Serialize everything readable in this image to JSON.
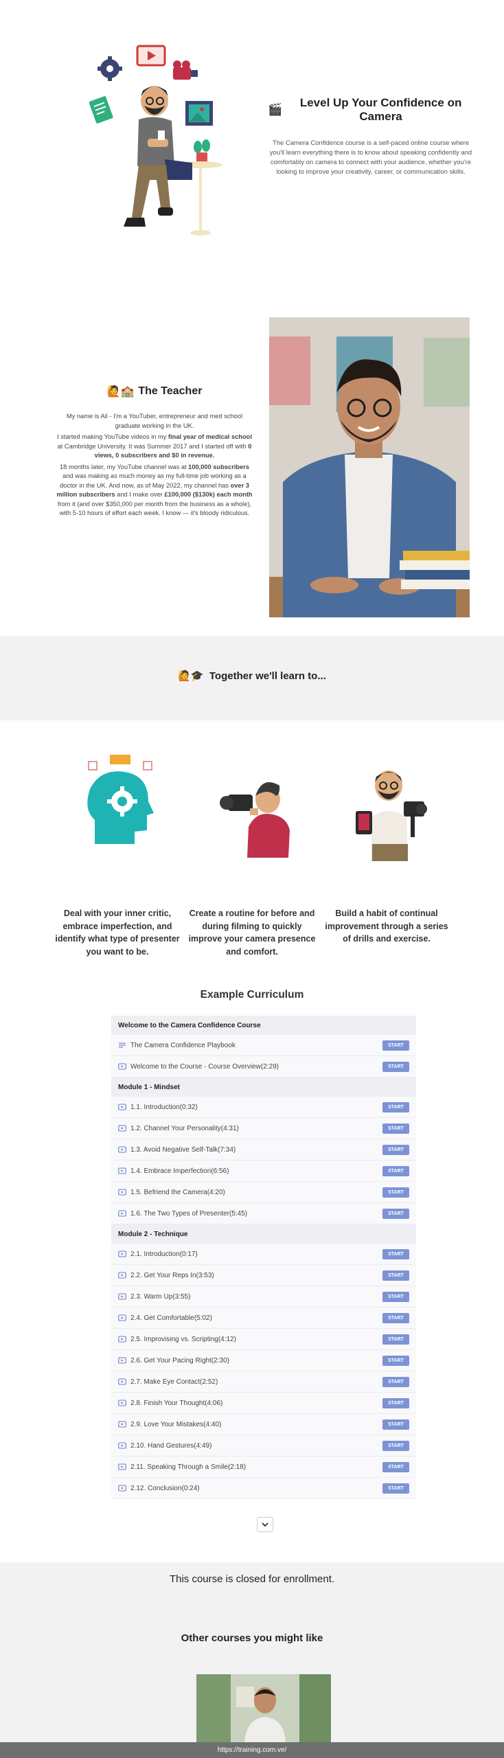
{
  "hero": {
    "title": "Level Up Your Confidence on Camera",
    "title_emoji": "🎬",
    "description": "The Camera Confidence course is a self-paced online course where you'll learn everything there is to know about speaking confidently and comfortably on camera to connect with your audience, whether you're looking to improve your creativity, career, or communication skills."
  },
  "teacher": {
    "title": "The Teacher",
    "title_emoji": "🙋🏫",
    "p1": "My name is Ali - I'm a YouTuber, entrepreneur and med school graduate working in the UK.",
    "p2_a": "I started making YouTube videos in my ",
    "p2_b": "final year of medical school",
    "p2_c": " at Cambridge University. It was Summer 2017 and I started off with ",
    "p2_d": "0 views, 0 subscribers and $0 in revenue.",
    "p3_a": "18 months later, my YouTube channel was at ",
    "p3_b": "100,000 subscribers",
    "p3_c": " and was making as much money as my full-time job working as a doctor in the UK. And now, as of May 2022, my channel has ",
    "p3_d": "over 3 million subscribers",
    "p3_e": " and I make over ",
    "p3_f": "£100,000 ($130k) each month",
    "p3_g": " from it (and over $350,000 per month from the business as a whole), with 5-10 hours of effort each week. I know — it's bloody ridiculous."
  },
  "learn": {
    "title": "Together we'll learn to...",
    "title_emoji": "🙋🎓"
  },
  "features": [
    {
      "text": "Deal with your inner critic, embrace imperfection, and identify what type of presenter you want to be."
    },
    {
      "text": "Create a routine for before and during filming to quickly improve your camera presence and comfort."
    },
    {
      "text": "Build a habit of continual improvement through a series of drills and exercise."
    }
  ],
  "curriculum": {
    "title": "Example Curriculum",
    "start_label": "START",
    "sections": [
      {
        "title": "Welcome to the Camera Confidence Course",
        "lectures": [
          {
            "name": "The Camera Confidence Playbook",
            "icon": "text-icon"
          },
          {
            "name": "Welcome to the Course - Course Overview(2:29)",
            "icon": "video-icon"
          }
        ]
      },
      {
        "title": "Module 1 - Mindset",
        "lectures": [
          {
            "name": "1.1. Introduction(0:32)",
            "icon": "video-icon"
          },
          {
            "name": "1.2. Channel Your Personality(4:31)",
            "icon": "video-icon"
          },
          {
            "name": "1.3. Avoid Negative Self-Talk(7:34)",
            "icon": "video-icon"
          },
          {
            "name": "1.4. Embrace Imperfection(6:56)",
            "icon": "video-icon"
          },
          {
            "name": "1.5. Befriend the Camera(4:20)",
            "icon": "video-icon"
          },
          {
            "name": "1.6. The Two Types of Presenter(5:45)",
            "icon": "video-icon"
          }
        ]
      },
      {
        "title": "Module 2 - Technique",
        "lectures": [
          {
            "name": "2.1. Introduction(0:17)",
            "icon": "video-icon"
          },
          {
            "name": "2.2. Get Your Reps In(3:53)",
            "icon": "video-icon"
          },
          {
            "name": "2.3. Warm Up(3:55)",
            "icon": "video-icon"
          },
          {
            "name": "2.4. Get Comfortable(5:02)",
            "icon": "video-icon"
          },
          {
            "name": "2.5. Improvising vs. Scripting(4:12)",
            "icon": "video-icon"
          },
          {
            "name": "2.6. Get Your Pacing Right(2:30)",
            "icon": "video-icon"
          },
          {
            "name": "2.7. Make Eye Contact(2:52)",
            "icon": "video-icon"
          },
          {
            "name": "2.8. Finish Your Thought(4:06)",
            "icon": "video-icon"
          },
          {
            "name": "2.9. Love Your Mistakes(4:40)",
            "icon": "video-icon"
          },
          {
            "name": "2.10. Hand Gestures(4:49)",
            "icon": "video-icon"
          },
          {
            "name": "2.11. Speaking Through a Smile(2:18)",
            "icon": "video-icon"
          },
          {
            "name": "2.12. Conclusion(0:24)",
            "icon": "video-icon"
          }
        ]
      }
    ]
  },
  "closed": {
    "text": "This course is closed for enrollment.",
    "other_title": "Other courses you might like"
  },
  "status_bar": {
    "url": "https://training.com.ve/"
  },
  "colors": {
    "accent": "#7d93d6",
    "banner_bg": "#f2f2f2",
    "status_bar": "#6f6f6f"
  }
}
